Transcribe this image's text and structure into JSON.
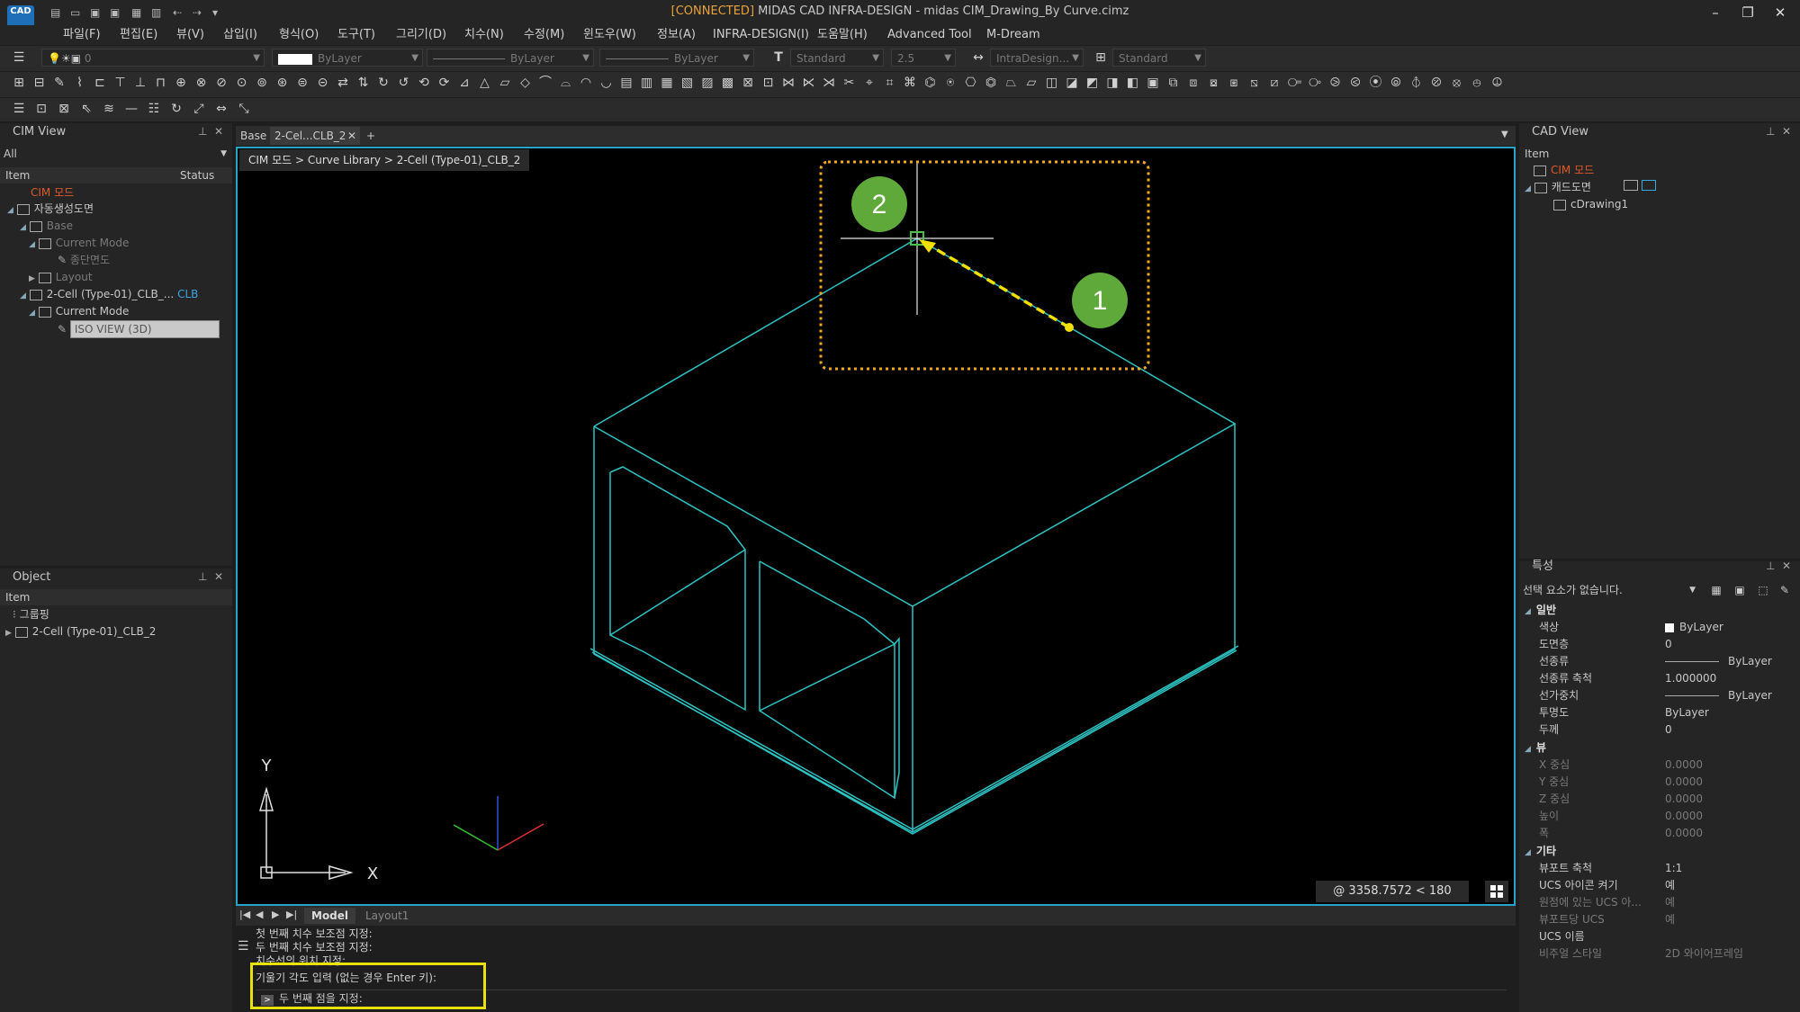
{
  "titlebar": {
    "connected": "[CONNECTED]",
    "app": " MIDAS CAD INFRA-DESIGN - midas CIM_Drawing_By Curve.cimz",
    "logo": "CAD"
  },
  "menu": [
    "파일(F)",
    "편집(E)",
    "뷰(V)",
    "삽입(I)",
    "형식(O)",
    "도구(T)",
    "그리기(D)",
    "치수(N)",
    "수정(M)",
    "윈도우(W)",
    "정보(A)",
    "INFRA-DESIGN(I)",
    "도움말(H)",
    "Advanced Tool",
    "M-Dream"
  ],
  "toolbar": {
    "layer_value": "0",
    "color": "ByLayer",
    "linetype": "ByLayer",
    "lineweight": "ByLayer",
    "text_style": "Standard",
    "text_height": "2.5",
    "dim_style": "IntraDesign...",
    "table_style": "Standard"
  },
  "cim_view": {
    "title": "CIM View",
    "filter": "All",
    "col_item": "Item",
    "col_status": "Status",
    "mode_label": "CIM 모드",
    "tree": [
      {
        "label": "자동생성도면",
        "level": 0,
        "expanded": true
      },
      {
        "label": "Base",
        "level": 1,
        "expanded": true
      },
      {
        "label": "Current Mode",
        "level": 2,
        "expanded": true
      },
      {
        "label": "종단면도",
        "level": 3
      },
      {
        "label": "Layout",
        "level": 2,
        "expanded": false
      },
      {
        "label": "2-Cell (Type-01)_CLB_...",
        "level": 1,
        "expanded": true,
        "badge": "CLB"
      },
      {
        "label": "Current Mode",
        "level": 2,
        "expanded": true
      },
      {
        "label": "ISO VIEW (3D)",
        "level": 3,
        "selected": true
      }
    ]
  },
  "object_panel": {
    "title": "Object",
    "col_item": "Item",
    "items": [
      {
        "label": "그룹핑"
      },
      {
        "label": "2-Cell (Type-01)_CLB_2"
      }
    ]
  },
  "doc_tabs": [
    {
      "label": "Base",
      "active": false
    },
    {
      "label": "2-Cel...CLB_2",
      "active": true
    }
  ],
  "viewport": {
    "breadcrumb": "CIM 모드 > Curve Library > 2-Cell (Type-01)_CLB_2",
    "coord": "@ 3358.7572 < 180",
    "ucs_y": "Y",
    "ucs_x": "X",
    "marker_1": "1",
    "marker_2": "2"
  },
  "model_tabs": [
    "Model",
    "Layout1"
  ],
  "command": {
    "lines": [
      "첫 번째 치수 보조점 지정:",
      "두 번째 치수 보조점 지정:",
      "치수선의 위치 지정:",
      "기울기 각도 입력 (없는 경우 Enter 키):"
    ],
    "prompt": "두 번째 점을 지정:"
  },
  "cad_view": {
    "title": "CAD View",
    "col_item": "Item",
    "mode_label": "CIM 모드",
    "tree": [
      {
        "label": "캐드도면",
        "level": 0
      },
      {
        "label": "cDrawing1",
        "level": 1
      }
    ]
  },
  "properties": {
    "title": "특성",
    "selection": "선택 요소가 없습니다.",
    "groups": [
      {
        "name": "일반",
        "rows": [
          {
            "k": "색상",
            "v": "ByLayer"
          },
          {
            "k": "도면층",
            "v": "0"
          },
          {
            "k": "선종류",
            "v": "ByLayer"
          },
          {
            "k": "선종류 축척",
            "v": "1.000000"
          },
          {
            "k": "선가중치",
            "v": "ByLayer"
          },
          {
            "k": "투명도",
            "v": "ByLayer"
          },
          {
            "k": "두께",
            "v": "0"
          }
        ]
      },
      {
        "name": "뷰",
        "rows": [
          {
            "k": "X 중심",
            "v": "0.0000"
          },
          {
            "k": "Y 중심",
            "v": "0.0000"
          },
          {
            "k": "Z 중심",
            "v": "0.0000"
          },
          {
            "k": "높이",
            "v": "0.0000"
          },
          {
            "k": "폭",
            "v": "0.0000"
          }
        ]
      },
      {
        "name": "기타",
        "rows": [
          {
            "k": "뷰포트 축척",
            "v": "1:1"
          },
          {
            "k": "UCS 아이콘 켜기",
            "v": "예"
          },
          {
            "k": "원점에 있는 UCS 아...",
            "v": "예"
          },
          {
            "k": "뷰포트당 UCS",
            "v": "예"
          },
          {
            "k": "UCS 이름",
            "v": ""
          },
          {
            "k": "비주얼 스타일",
            "v": "2D 와이어프레임"
          }
        ]
      }
    ]
  },
  "colors": {
    "accent": "#28a4c8",
    "highlight": "#e8e20a",
    "marker": "#5fa83a",
    "mode": "#e05a2a"
  }
}
